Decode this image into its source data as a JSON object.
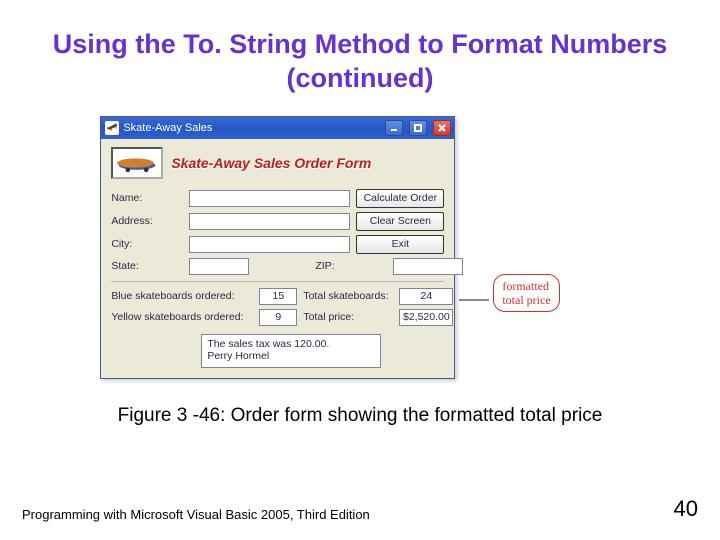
{
  "slide": {
    "title": "Using the To. String Method to Format Numbers (continued)",
    "caption": "Figure 3 -46: Order form showing the formatted total price",
    "footer": "Programming with Microsoft Visual Basic 2005, Third Edition",
    "page": "40"
  },
  "window": {
    "title": "Skate-Away Sales",
    "form_title": "Skate-Away Sales Order Form"
  },
  "labels": {
    "name": "Name:",
    "address": "Address:",
    "city": "City:",
    "state": "State:",
    "zip": "ZIP:",
    "blue": "Blue skateboards ordered:",
    "yellow": "Yellow skateboards ordered:",
    "total_sb": "Total skateboards:",
    "total_price": "Total price:"
  },
  "buttons": {
    "calc": "Calculate Order",
    "clear": "Clear Screen",
    "exit": "Exit"
  },
  "values": {
    "name": "",
    "address": "",
    "city": "",
    "state": "",
    "zip": "",
    "blue": "15",
    "yellow": "9",
    "total_sb": "24",
    "total_price": "$2,520.00",
    "message_line1": "The sales tax was 120.00.",
    "message_line2": "Perry Hormel"
  },
  "annotation": {
    "line1": "formatted",
    "line2": "total price"
  }
}
